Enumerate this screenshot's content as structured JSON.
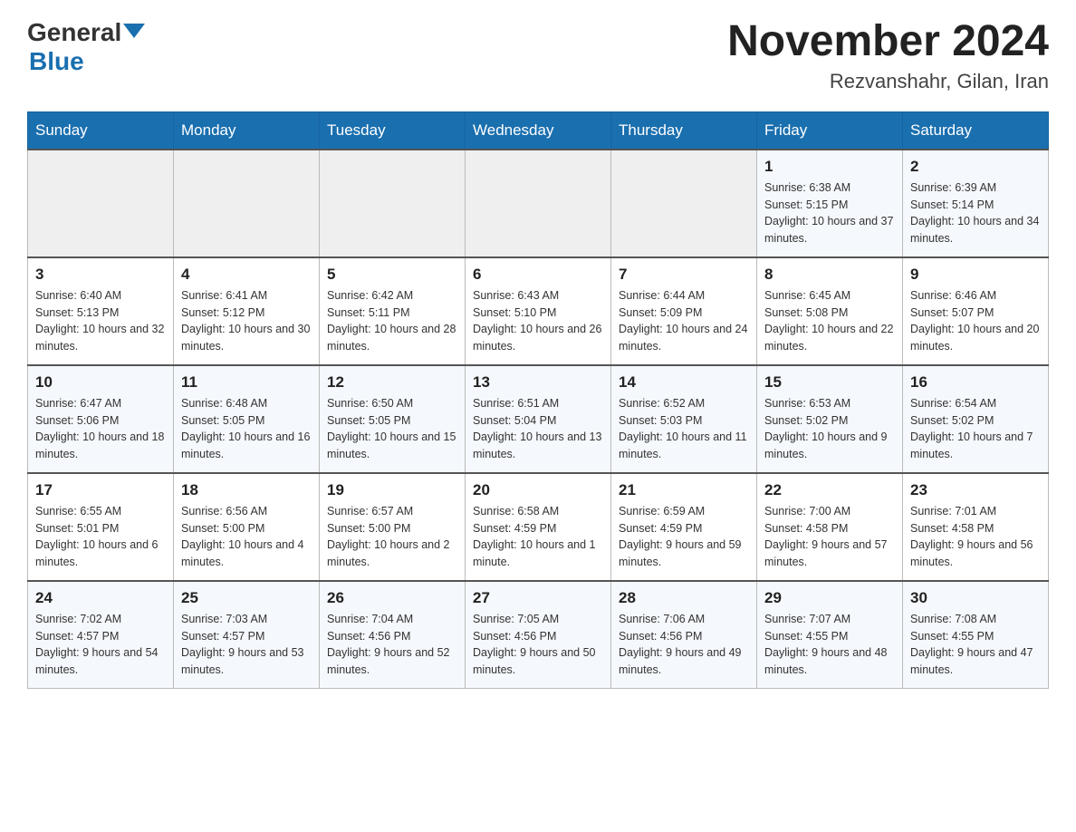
{
  "header": {
    "title": "November 2024",
    "subtitle": "Rezvanshahr, Gilan, Iran",
    "logo_general": "General",
    "logo_blue": "Blue"
  },
  "weekdays": [
    "Sunday",
    "Monday",
    "Tuesday",
    "Wednesday",
    "Thursday",
    "Friday",
    "Saturday"
  ],
  "weeks": [
    [
      {
        "day": "",
        "info": ""
      },
      {
        "day": "",
        "info": ""
      },
      {
        "day": "",
        "info": ""
      },
      {
        "day": "",
        "info": ""
      },
      {
        "day": "",
        "info": ""
      },
      {
        "day": "1",
        "info": "Sunrise: 6:38 AM\nSunset: 5:15 PM\nDaylight: 10 hours and 37 minutes."
      },
      {
        "day": "2",
        "info": "Sunrise: 6:39 AM\nSunset: 5:14 PM\nDaylight: 10 hours and 34 minutes."
      }
    ],
    [
      {
        "day": "3",
        "info": "Sunrise: 6:40 AM\nSunset: 5:13 PM\nDaylight: 10 hours and 32 minutes."
      },
      {
        "day": "4",
        "info": "Sunrise: 6:41 AM\nSunset: 5:12 PM\nDaylight: 10 hours and 30 minutes."
      },
      {
        "day": "5",
        "info": "Sunrise: 6:42 AM\nSunset: 5:11 PM\nDaylight: 10 hours and 28 minutes."
      },
      {
        "day": "6",
        "info": "Sunrise: 6:43 AM\nSunset: 5:10 PM\nDaylight: 10 hours and 26 minutes."
      },
      {
        "day": "7",
        "info": "Sunrise: 6:44 AM\nSunset: 5:09 PM\nDaylight: 10 hours and 24 minutes."
      },
      {
        "day": "8",
        "info": "Sunrise: 6:45 AM\nSunset: 5:08 PM\nDaylight: 10 hours and 22 minutes."
      },
      {
        "day": "9",
        "info": "Sunrise: 6:46 AM\nSunset: 5:07 PM\nDaylight: 10 hours and 20 minutes."
      }
    ],
    [
      {
        "day": "10",
        "info": "Sunrise: 6:47 AM\nSunset: 5:06 PM\nDaylight: 10 hours and 18 minutes."
      },
      {
        "day": "11",
        "info": "Sunrise: 6:48 AM\nSunset: 5:05 PM\nDaylight: 10 hours and 16 minutes."
      },
      {
        "day": "12",
        "info": "Sunrise: 6:50 AM\nSunset: 5:05 PM\nDaylight: 10 hours and 15 minutes."
      },
      {
        "day": "13",
        "info": "Sunrise: 6:51 AM\nSunset: 5:04 PM\nDaylight: 10 hours and 13 minutes."
      },
      {
        "day": "14",
        "info": "Sunrise: 6:52 AM\nSunset: 5:03 PM\nDaylight: 10 hours and 11 minutes."
      },
      {
        "day": "15",
        "info": "Sunrise: 6:53 AM\nSunset: 5:02 PM\nDaylight: 10 hours and 9 minutes."
      },
      {
        "day": "16",
        "info": "Sunrise: 6:54 AM\nSunset: 5:02 PM\nDaylight: 10 hours and 7 minutes."
      }
    ],
    [
      {
        "day": "17",
        "info": "Sunrise: 6:55 AM\nSunset: 5:01 PM\nDaylight: 10 hours and 6 minutes."
      },
      {
        "day": "18",
        "info": "Sunrise: 6:56 AM\nSunset: 5:00 PM\nDaylight: 10 hours and 4 minutes."
      },
      {
        "day": "19",
        "info": "Sunrise: 6:57 AM\nSunset: 5:00 PM\nDaylight: 10 hours and 2 minutes."
      },
      {
        "day": "20",
        "info": "Sunrise: 6:58 AM\nSunset: 4:59 PM\nDaylight: 10 hours and 1 minute."
      },
      {
        "day": "21",
        "info": "Sunrise: 6:59 AM\nSunset: 4:59 PM\nDaylight: 9 hours and 59 minutes."
      },
      {
        "day": "22",
        "info": "Sunrise: 7:00 AM\nSunset: 4:58 PM\nDaylight: 9 hours and 57 minutes."
      },
      {
        "day": "23",
        "info": "Sunrise: 7:01 AM\nSunset: 4:58 PM\nDaylight: 9 hours and 56 minutes."
      }
    ],
    [
      {
        "day": "24",
        "info": "Sunrise: 7:02 AM\nSunset: 4:57 PM\nDaylight: 9 hours and 54 minutes."
      },
      {
        "day": "25",
        "info": "Sunrise: 7:03 AM\nSunset: 4:57 PM\nDaylight: 9 hours and 53 minutes."
      },
      {
        "day": "26",
        "info": "Sunrise: 7:04 AM\nSunset: 4:56 PM\nDaylight: 9 hours and 52 minutes."
      },
      {
        "day": "27",
        "info": "Sunrise: 7:05 AM\nSunset: 4:56 PM\nDaylight: 9 hours and 50 minutes."
      },
      {
        "day": "28",
        "info": "Sunrise: 7:06 AM\nSunset: 4:56 PM\nDaylight: 9 hours and 49 minutes."
      },
      {
        "day": "29",
        "info": "Sunrise: 7:07 AM\nSunset: 4:55 PM\nDaylight: 9 hours and 48 minutes."
      },
      {
        "day": "30",
        "info": "Sunrise: 7:08 AM\nSunset: 4:55 PM\nDaylight: 9 hours and 47 minutes."
      }
    ]
  ]
}
